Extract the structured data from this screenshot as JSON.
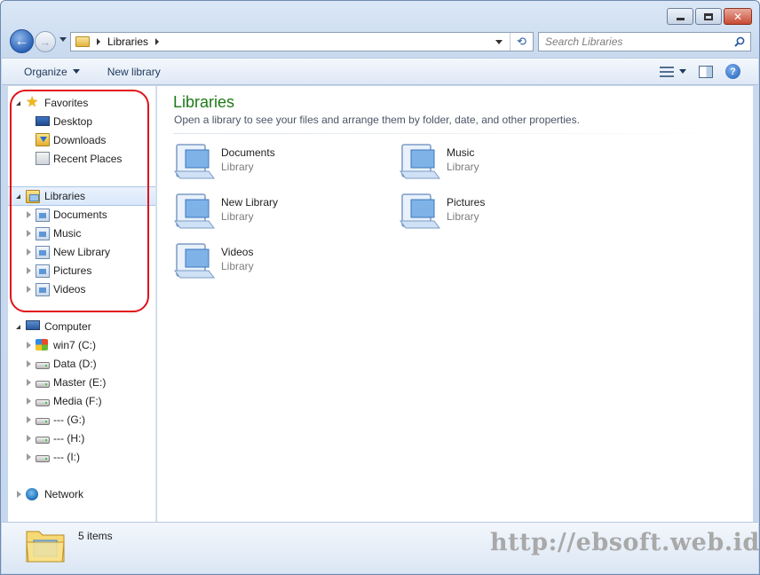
{
  "window": {
    "caption_buttons": {
      "minimize": "minimize-icon",
      "maximize": "maximize-icon",
      "close": "✕"
    }
  },
  "nav": {
    "back_glyph": "←",
    "forward_glyph": "→",
    "address": {
      "crumbs": [
        "Libraries"
      ]
    },
    "refresh_glyph": "⟲",
    "search": {
      "placeholder": "Search Libraries"
    }
  },
  "toolbar": {
    "organize_label": "Organize",
    "new_library_label": "New library",
    "help_glyph": "?"
  },
  "sidebar": {
    "favorites": {
      "label": "Favorites",
      "items": [
        {
          "label": "Desktop",
          "icon": "desktop-icon"
        },
        {
          "label": "Downloads",
          "icon": "downloads-icon"
        },
        {
          "label": "Recent Places",
          "icon": "recent-places-icon"
        }
      ]
    },
    "libraries": {
      "label": "Libraries",
      "items": [
        {
          "label": "Documents"
        },
        {
          "label": "Music"
        },
        {
          "label": "New Library"
        },
        {
          "label": "Pictures"
        },
        {
          "label": "Videos"
        }
      ]
    },
    "computer": {
      "label": "Computer",
      "items": [
        {
          "label": "win7 (C:)",
          "icon": "windows-drive-icon"
        },
        {
          "label": "Data (D:)",
          "icon": "drive-icon"
        },
        {
          "label": "Master (E:)",
          "icon": "drive-icon"
        },
        {
          "label": "Media (F:)",
          "icon": "drive-icon"
        },
        {
          "label": "--- (G:)",
          "icon": "drive-icon"
        },
        {
          "label": "--- (H:)",
          "icon": "drive-icon"
        },
        {
          "label": "--- (I:)",
          "icon": "drive-icon"
        }
      ]
    },
    "network": {
      "label": "Network"
    }
  },
  "main": {
    "title": "Libraries",
    "subtitle": "Open a library to see your files and arrange them by folder, date, and other properties.",
    "libraries": [
      {
        "name": "Documents",
        "type": "Library"
      },
      {
        "name": "Music",
        "type": "Library"
      },
      {
        "name": "New Library",
        "type": "Library"
      },
      {
        "name": "Pictures",
        "type": "Library"
      },
      {
        "name": "Videos",
        "type": "Library"
      }
    ]
  },
  "details": {
    "item_count": "5 items",
    "watermark": "http://ebsoft.web.id"
  },
  "colors": {
    "title_green": "#1e7a16",
    "highlight_red": "#e0121b",
    "selection_blue": "#d9e8fb"
  }
}
